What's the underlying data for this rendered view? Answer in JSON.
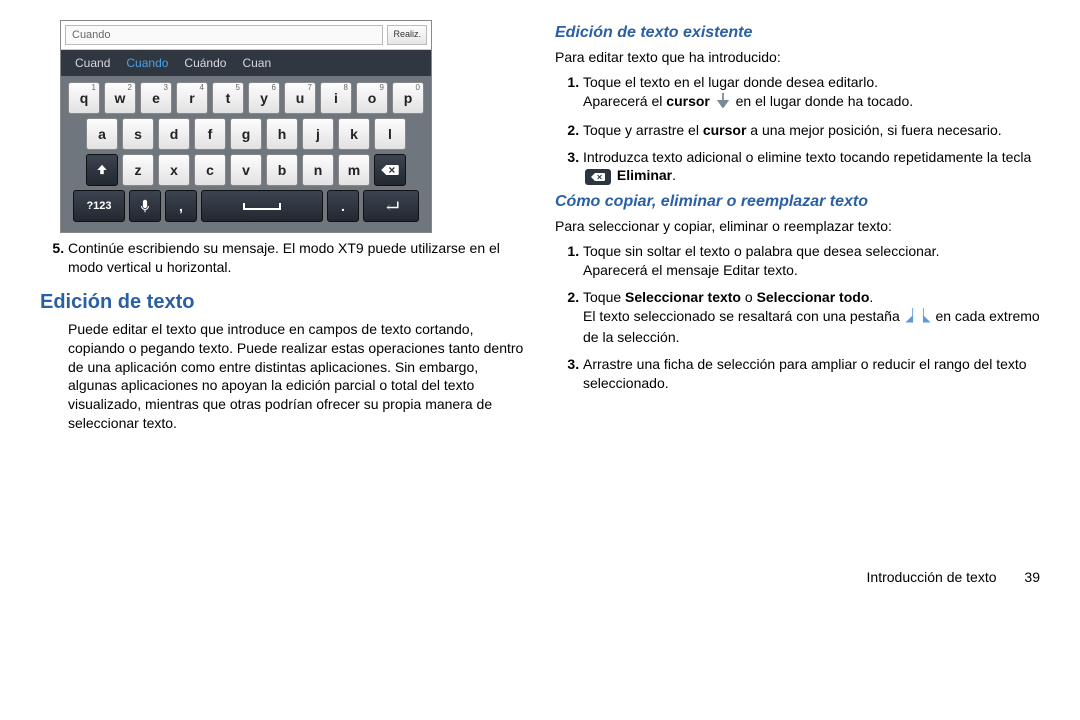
{
  "keyboard": {
    "input_value": "Cuando",
    "done_label": "Realiz.",
    "suggestions": [
      "Cuand",
      "Cuando",
      "Cuándo",
      "Cuan"
    ],
    "row1": [
      {
        "k": "q",
        "n": "1"
      },
      {
        "k": "w",
        "n": "2"
      },
      {
        "k": "e",
        "n": "3"
      },
      {
        "k": "r",
        "n": "4"
      },
      {
        "k": "t",
        "n": "5"
      },
      {
        "k": "y",
        "n": "6"
      },
      {
        "k": "u",
        "n": "7"
      },
      {
        "k": "i",
        "n": "8"
      },
      {
        "k": "o",
        "n": "9"
      },
      {
        "k": "p",
        "n": "0"
      }
    ],
    "row2": [
      "a",
      "s",
      "d",
      "f",
      "g",
      "h",
      "j",
      "k",
      "l"
    ],
    "row3": [
      "z",
      "x",
      "c",
      "v",
      "b",
      "n",
      "m"
    ],
    "sym_label": "?123",
    "period": ".",
    "comma": ","
  },
  "left": {
    "step5": "Continúe escribiendo su mensaje. El modo XT9 puede utilizarse en el modo vertical u horizontal.",
    "h2": "Edición de texto",
    "p": "Puede editar el texto que introduce en campos de texto cortando, copiando o pegando texto. Puede realizar estas operaciones tanto dentro de una aplicación como entre distintas aplicaciones. Sin embargo, algunas aplicaciones no apoyan la edición parcial o total del texto visualizado, mientras que otras podrían ofrecer su propia manera de seleccionar texto."
  },
  "right": {
    "h3a": "Edición de texto existente",
    "pa": "Para editar texto que ha introducido:",
    "li1a": "Toque el texto en el lugar donde desea editarlo.",
    "li1b_pre": "Aparecerá el ",
    "li1b_bold": "cursor",
    "li1b_post": " en el lugar donde ha tocado.",
    "li2_pre": "Toque y arrastre el ",
    "li2_bold": "cursor",
    "li2_post": " a una mejor posición, si fuera necesario.",
    "li3_pre": "Introduzca texto adicional o elimine texto tocando repetidamente la tecla ",
    "li3_bold": "Eliminar",
    "li3_post": ".",
    "h3b": "Cómo copiar, eliminar o reemplazar texto",
    "pb": "Para seleccionar y copiar, eliminar o reemplazar texto:",
    "lib1a": "Toque sin soltar el texto o palabra que desea seleccionar.",
    "lib1b": "Aparecerá el mensaje Editar texto.",
    "lib2_pre": "Toque ",
    "lib2_bold1": "Seleccionar texto",
    "lib2_mid": " o ",
    "lib2_bold2": "Seleccionar todo",
    "lib2_post": ".",
    "lib2b_pre": "El texto seleccionado se resaltará con una pestaña ",
    "lib2b_post": " en cada extremo de la selección.",
    "lib3": "Arrastre una ficha de selección para ampliar o reducir el rango del texto seleccionado."
  },
  "footer": {
    "section": "Introducción de texto",
    "page": "39"
  }
}
